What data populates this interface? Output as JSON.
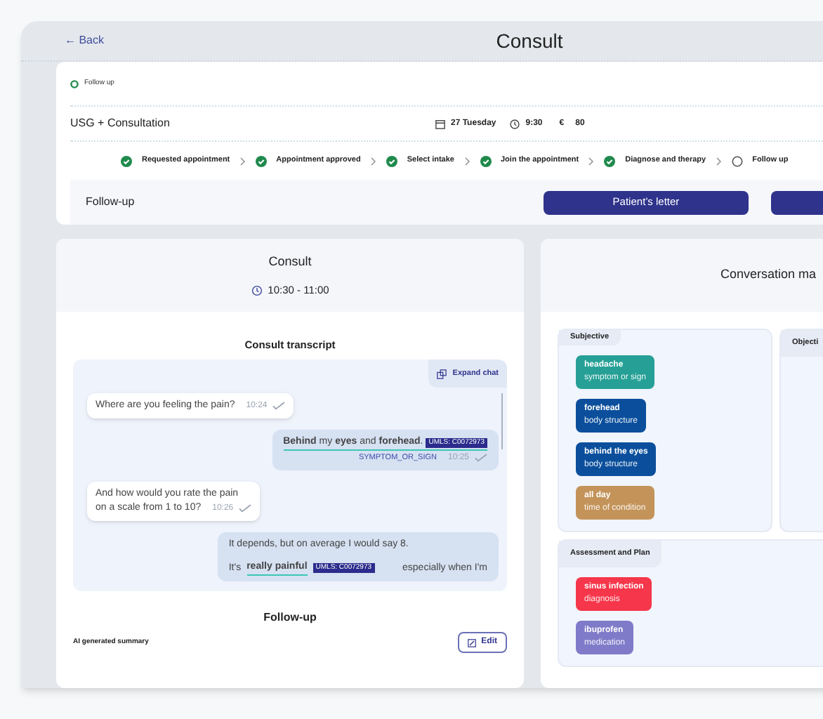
{
  "header": {
    "back": "← Back",
    "title": "Consult"
  },
  "appointment": {
    "status": {
      "label": "Follow up",
      "active": true
    },
    "name": "USG + Consultation",
    "date": "27 Tuesday",
    "time": "9:30",
    "currency": "€",
    "price": "80"
  },
  "steps": [
    {
      "label": "Requested appointment",
      "done": true
    },
    {
      "label": "Appointment approved",
      "done": true
    },
    {
      "label": "Select intake",
      "done": true
    },
    {
      "label": "Join the appointment",
      "done": true
    },
    {
      "label": "Diagnose and therapy",
      "done": true
    },
    {
      "label": "Follow up",
      "done": false
    }
  ],
  "follow_up_bar": {
    "title": "Follow-up",
    "buttons": [
      "Patient’s letter"
    ]
  },
  "consult": {
    "title": "Consult",
    "time": "10:30 - 11:00",
    "transcript_title": "Consult transcript",
    "expand": "Expand chat",
    "messages": [
      {
        "kind": "incoming",
        "lines": [
          "Where are you feeling the pain?"
        ],
        "time": "10:24",
        "read": true
      },
      {
        "kind": "outgoing",
        "lines": [
          "**Behind** my **eyes** and **forehead**."
        ],
        "annotation": {
          "code": "UMLS: C0072973",
          "type": "SYMPTOM_OR_SIGN"
        },
        "time": "10:25",
        "read": true
      },
      {
        "kind": "incoming",
        "lines": [
          "And how would you rate the pain",
          "on a scale from 1 to 10?"
        ],
        "time": "10:26",
        "read": true
      },
      {
        "kind": "outgoing",
        "lines": [
          "It depends, but on average I would say 8."
        ],
        "tail": {
          "before": "It's",
          "highlight": "really painful",
          "code": "UMLS: C0072973",
          "after": "especially when I'm"
        }
      }
    ],
    "follow_up_title": "Follow-up",
    "summary_label": "AI generated summary",
    "edit": "Edit"
  },
  "conversation": {
    "title": "Conversation ma",
    "sections": [
      {
        "title": "Subjective",
        "tags": [
          {
            "term": "headache",
            "category": "symptom or sign",
            "color": "#26a096"
          },
          {
            "term": "forehead",
            "category": "body structure",
            "color": "#0b4f9c"
          },
          {
            "term": "behind the eyes",
            "category": "body structure",
            "color": "#0b4f9c"
          },
          {
            "term": "all day",
            "category": "time of condition",
            "color": "#c39359"
          }
        ]
      },
      {
        "title": "Objecti"
      },
      {
        "title": "Assessment and Plan",
        "tags": [
          {
            "term": "sinus infection",
            "category": "diagnosis",
            "color": "#f6364a"
          },
          {
            "term": "ibuprofen",
            "category": "medication",
            "color": "#7f7bc9"
          }
        ]
      }
    ]
  }
}
